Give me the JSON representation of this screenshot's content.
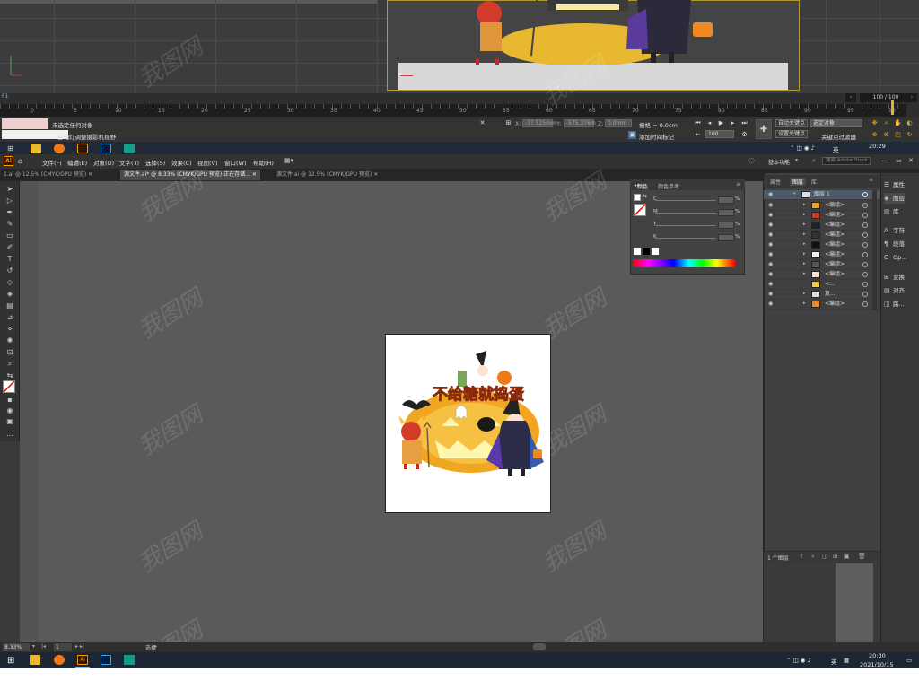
{
  "timeline": {
    "ticks": [
      "0",
      "5",
      "10",
      "15",
      "20",
      "25",
      "30",
      "35",
      "40",
      "45",
      "50",
      "55",
      "60",
      "65",
      "70",
      "75",
      "80",
      "85",
      "90",
      "95",
      "10"
    ],
    "frame_counter": "100 / 100",
    "corner_label": "F1"
  },
  "props": {
    "no_selection": "未选定任何对象",
    "camera_note": "自动灯调整摄影机视野",
    "x_label": "X:",
    "x_value": "-37.525mm",
    "y_label": "Y:",
    "y_value": "-575.376m",
    "z_label": "Z:",
    "z_value": "0.0mm",
    "grid_label": "栅格 = 0.0cm",
    "add_time_tag": "添加时间标记",
    "auto_key": "自动关键点",
    "selected_object": "选定对象",
    "set_key": "设置关键点",
    "key_filter": "关键点过滤器",
    "frame_input": "100"
  },
  "taskbar_top": {
    "time": "20:29",
    "lang": "英"
  },
  "menubar": {
    "logo": "Ai",
    "items": [
      "文件(F)",
      "编辑(E)",
      "对象(O)",
      "文字(T)",
      "选择(S)",
      "效果(C)",
      "视图(V)",
      "窗口(W)",
      "帮助(H)"
    ],
    "workspace": "基本功能",
    "search_placeholder": "搜索 Adobe Stock"
  },
  "tabs": [
    {
      "label": "1.ai @ 12.5% (CMYK/GPU 预览)",
      "active": false
    },
    {
      "label": "源文件.ai* @ 8.33% (CMYK/GPU 预览) 正在存储...",
      "active": true
    },
    {
      "label": "源文件.ai @ 12.5% (CMYK/GPU 预览)",
      "active": false
    }
  ],
  "color_panel": {
    "tab_color": "颜色",
    "tab_guide": "颜色参考",
    "channels": [
      "C",
      "M",
      "Y",
      "K"
    ],
    "values": [
      "%",
      "%",
      "%",
      "%"
    ]
  },
  "layers_panel": {
    "tabs": [
      "属性",
      "图层",
      "库"
    ],
    "top_layer": "图层 1",
    "rows": [
      "<编组>",
      "<编组>",
      "<编组>",
      "<编组>",
      "<编组>",
      "<编组>",
      "<编组>",
      "<编组>",
      "<...",
      "复...",
      "<编组>"
    ],
    "footer_count": "1 个图层"
  },
  "right_dock": {
    "items": [
      "属性",
      "图层",
      "库",
      "字符",
      "段落",
      "Op...",
      "变换",
      "对齐",
      "路..."
    ]
  },
  "status": {
    "zoom": "8.33%",
    "page": "1",
    "mode": "选择"
  },
  "taskbar": {
    "lang": "英",
    "time": "20:30",
    "date": "2021/10/15"
  },
  "artwork": {
    "title": "不给糖就捣蛋"
  },
  "watermark": "我图网"
}
